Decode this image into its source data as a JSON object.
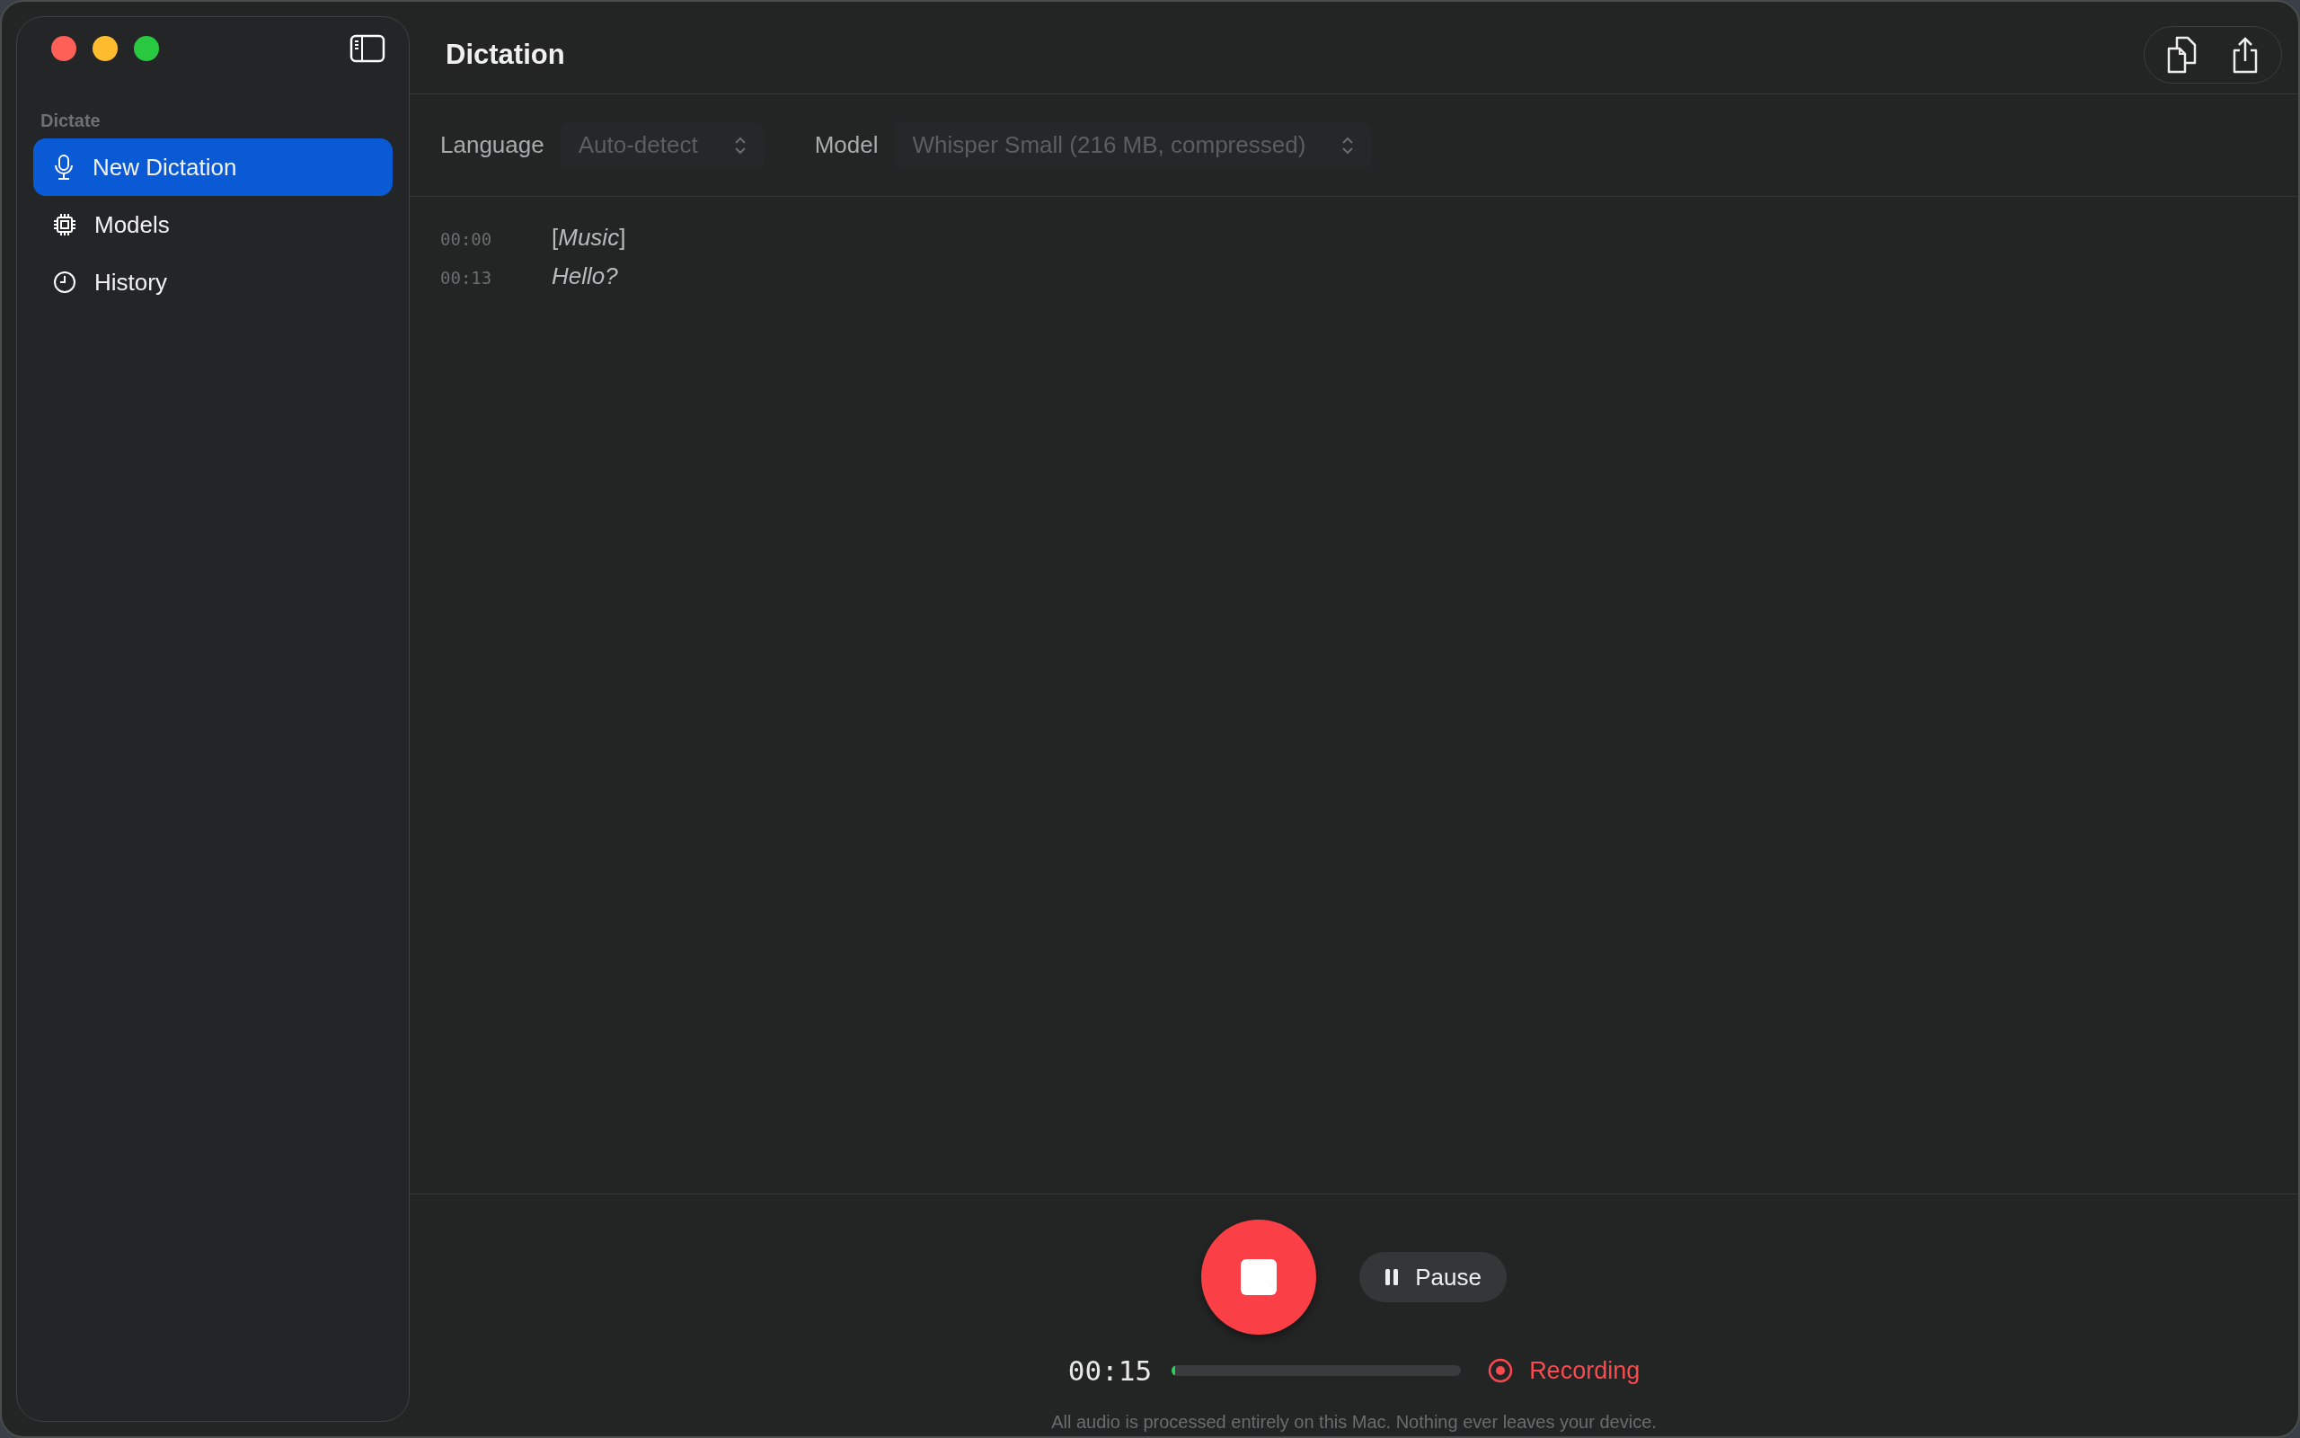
{
  "window": {
    "title": "Dictation"
  },
  "sidebar": {
    "section": "Dictate",
    "items": [
      {
        "label": "New Dictation",
        "kind": "mic",
        "selected": true
      },
      {
        "label": "Models",
        "kind": "chip",
        "selected": false
      },
      {
        "label": "History",
        "kind": "clock",
        "selected": false
      }
    ]
  },
  "toolbar": {
    "fields": [
      {
        "label": "Language",
        "value": "Auto-detect",
        "disabled": true
      },
      {
        "label": "Model",
        "value": "Whisper Small (216 MB, compressed)",
        "disabled": true
      }
    ]
  },
  "transcript": [
    {
      "time": "00:00",
      "text": "[*Music*]",
      "italic": false
    },
    {
      "time": "00:13",
      "text": "Hello?",
      "italic": true
    }
  ],
  "controls": {
    "pause_label": "Pause",
    "elapsed": "00:15",
    "level": 0.01,
    "status": "Recording",
    "recording": true
  },
  "footnote": "All audio is processed entirely on this Mac. Nothing ever leaves your device."
}
